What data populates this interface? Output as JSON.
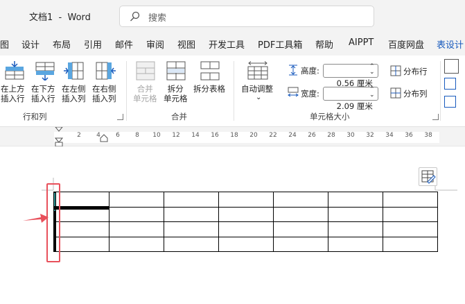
{
  "titlebar": {
    "doc_title": "文档1  -  Word",
    "search_placeholder": "搜索"
  },
  "tabs": [
    {
      "label": "图"
    },
    {
      "label": "设计"
    },
    {
      "label": "布局"
    },
    {
      "label": "引用"
    },
    {
      "label": "邮件"
    },
    {
      "label": "审阅"
    },
    {
      "label": "视图"
    },
    {
      "label": "开发工具"
    },
    {
      "label": "PDF工具箱"
    },
    {
      "label": "帮助"
    },
    {
      "label": "AIPPT"
    },
    {
      "label": "百度网盘"
    },
    {
      "label": "表设计"
    }
  ],
  "ribbon": {
    "rows_cols": {
      "insert_above": "在上方\n插入行",
      "insert_below": "在下方\n插入行",
      "insert_left": "在左侧\n插入列",
      "insert_right": "在右侧\n插入列",
      "group_label": "行和列"
    },
    "merge": {
      "merge_cells": "合并\n单元格",
      "split_cells": "拆分\n单元格",
      "split_table": "拆分表格",
      "group_label": "合并"
    },
    "cell_size": {
      "autofit": "自动调整",
      "height_label": "高度:",
      "height_value": "0.56 厘米",
      "width_label": "宽度:",
      "width_value": "2.09 厘米",
      "distribute_rows": "分布行",
      "distribute_cols": "分布列",
      "group_label": "单元格大小"
    }
  },
  "ruler": {
    "ticks": [
      "2",
      "4",
      "6",
      "8",
      "10",
      "12",
      "14",
      "16",
      "18",
      "20",
      "22",
      "24",
      "26",
      "28",
      "30",
      "32",
      "34",
      "36",
      "38"
    ]
  },
  "colors": {
    "accent": "#185abd",
    "highlight": "#e8505b",
    "arrow": "#e8505b"
  }
}
